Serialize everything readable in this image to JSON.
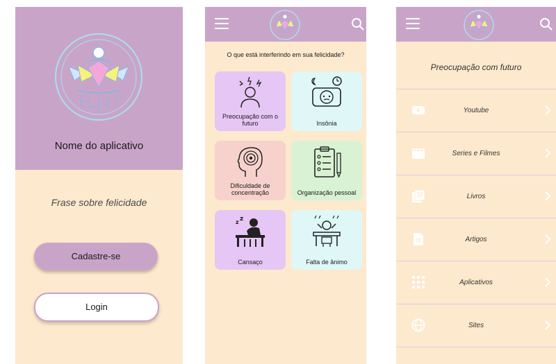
{
  "screen1": {
    "app_name": "Nome do aplicativo",
    "phrase": "Frase sobre felicidade",
    "signup_label": "Cadastre-se",
    "login_label": "Login"
  },
  "screen2": {
    "menu_icon": "hamburger-menu-icon",
    "search_icon": "search-icon",
    "question": "O que está interferindo em sua felicidade?",
    "cards": [
      {
        "label": "Preocupação com o futuro",
        "icon": "worried-person-icon",
        "color": "#e6c6f5"
      },
      {
        "label": "Insônia",
        "icon": "insomnia-icon",
        "color": "#dff7f7"
      },
      {
        "label": "Dificuldade de concentração",
        "icon": "head-target-icon",
        "color": "#f7d2cc"
      },
      {
        "label": "Organização pessoal",
        "icon": "checklist-icon",
        "color": "#d9f2d4"
      },
      {
        "label": "Cansaço",
        "icon": "tired-person-icon",
        "color": "#e6c6f5"
      },
      {
        "label": "Falta de ânimo",
        "icon": "despair-person-icon",
        "color": "#dff7f7"
      }
    ]
  },
  "screen3": {
    "title": "Preocupação com futuro",
    "items": [
      {
        "label": "Youtube",
        "icon": "youtube-icon"
      },
      {
        "label": "Series e Filmes",
        "icon": "clapperboard-icon"
      },
      {
        "label": "Livros",
        "icon": "library-icon"
      },
      {
        "label": "Artigos",
        "icon": "document-icon"
      },
      {
        "label": "Aplicativos",
        "icon": "apps-grid-icon"
      },
      {
        "label": "Sites",
        "icon": "globe-icon"
      }
    ]
  },
  "colors": {
    "header": "#c9a4c9",
    "background": "#fde9cd",
    "divider": "#e6c6ec",
    "icon_light": "#ffffff"
  }
}
